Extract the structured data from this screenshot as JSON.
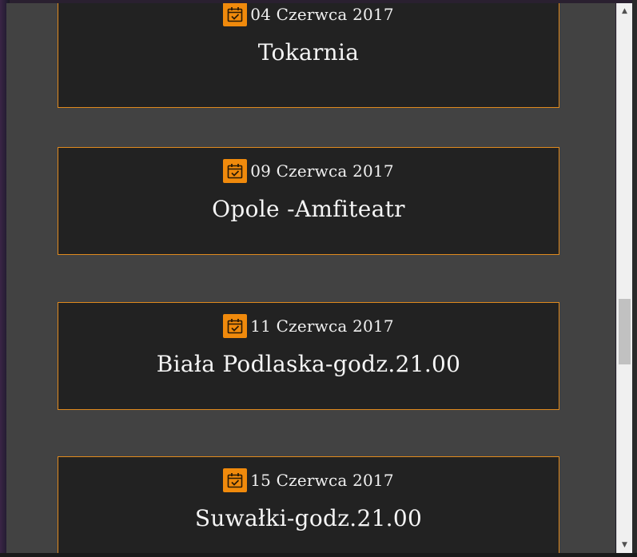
{
  "events": [
    {
      "date": "04 Czerwca 2017",
      "title": "Tokarnia"
    },
    {
      "date": "09 Czerwca 2017",
      "title": "Opole -Amfiteatr"
    },
    {
      "date": "11 Czerwca 2017",
      "title": "Biała Podlaska-godz.21.00"
    },
    {
      "date": "15 Czerwca 2017",
      "title": "Suwałki-godz.21.00"
    }
  ],
  "icons": {
    "calendar": "calendar-check-icon",
    "scroll_up": "scroll-up-arrow",
    "scroll_down": "scroll-down-arrow"
  },
  "colors": {
    "accent": "#f08a0c",
    "card_border": "#e08a1e",
    "card_bg": "#222222",
    "modal_bg": "#424242"
  },
  "scroll": {
    "position_fraction": 0.56
  }
}
